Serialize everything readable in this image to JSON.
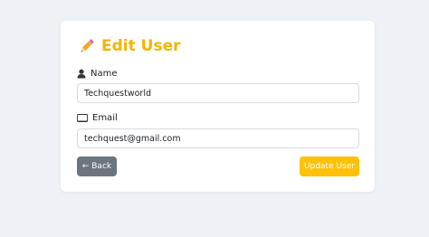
{
  "page": {
    "background": "#eef1f6"
  },
  "card": {
    "title": "Edit User",
    "title_icon": "pencil-icon",
    "accent_color": "#f5b400"
  },
  "form": {
    "name": {
      "label": "Name",
      "icon": "user-icon",
      "value": "Techquestworld"
    },
    "email": {
      "label": "Email",
      "icon": "envelope-icon",
      "value": "techquest@gmail.com"
    }
  },
  "actions": {
    "back_label": "← Back",
    "back_color": "#6c757d",
    "update_label": "Update User",
    "update_color": "#ffc107"
  }
}
